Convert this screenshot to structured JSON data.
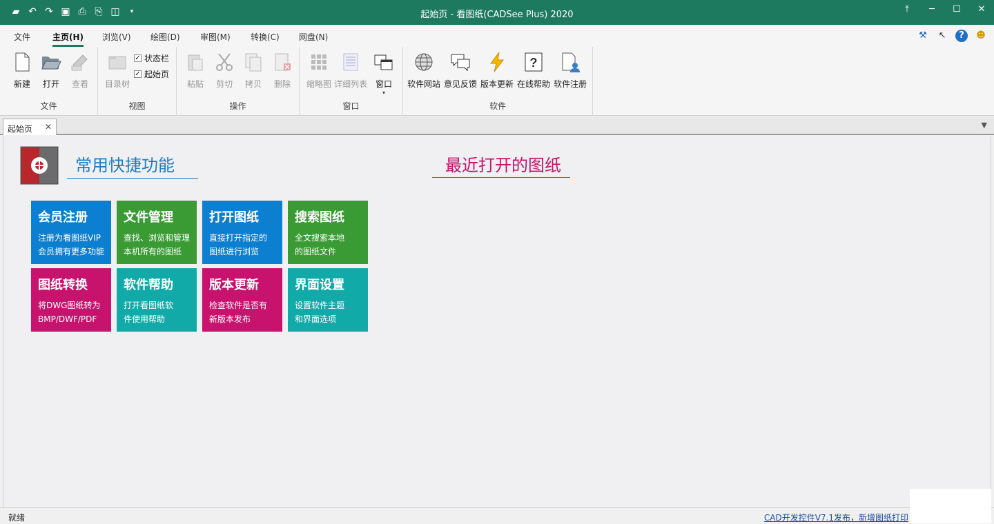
{
  "window": {
    "title": "起始页 - 看图纸(CADSee Plus) 2020"
  },
  "menu": {
    "tabs": [
      "文件",
      "主页(H)",
      "浏览(V)",
      "绘图(D)",
      "审图(M)",
      "转换(C)",
      "网盘(N)"
    ]
  },
  "ribbon": {
    "file": {
      "label": "文件",
      "new": "新建",
      "open": "打开",
      "view": "查看"
    },
    "view": {
      "label": "视图",
      "tree": "目录树",
      "statusbar": "状态栏",
      "startpage": "起始页"
    },
    "ops": {
      "label": "操作",
      "paste": "粘贴",
      "cut": "剪切",
      "copy": "拷贝",
      "delete": "删除"
    },
    "window": {
      "label": "窗口",
      "thumb": "缩略图",
      "detail": "详细列表",
      "win": "窗口"
    },
    "soft": {
      "label": "软件",
      "site": "软件网站",
      "feedback": "意见反馈",
      "update": "版本更新",
      "help": "在线帮助",
      "register": "软件注册"
    }
  },
  "doc_tab": {
    "label": "起始页"
  },
  "content": {
    "quick_title": "常用快捷功能",
    "recent_title": "最近打开的图纸",
    "tiles": [
      {
        "title": "会员注册",
        "desc1": "注册为看图纸VIP",
        "desc2": "会员拥有更多功能"
      },
      {
        "title": "文件管理",
        "desc1": "查找、浏览和管理",
        "desc2": "本机所有的图纸"
      },
      {
        "title": "打开图纸",
        "desc1": "直接打开指定的",
        "desc2": "图纸进行浏览"
      },
      {
        "title": "搜索图纸",
        "desc1": "全文搜索本地",
        "desc2": "的图纸文件"
      },
      {
        "title": "图纸转换",
        "desc1": "将DWG图纸转为",
        "desc2": "BMP/DWF/PDF"
      },
      {
        "title": "软件帮助",
        "desc1": "打开看图纸软",
        "desc2": "件使用帮助"
      },
      {
        "title": "版本更新",
        "desc1": "检查软件是否有",
        "desc2": "新版本发布"
      },
      {
        "title": "界面设置",
        "desc1": "设置软件主题",
        "desc2": "和界面选项"
      }
    ]
  },
  "status": {
    "left": "就绪",
    "right": "CAD开发控件V7.1发布，新增图纸打印"
  },
  "colors": {
    "titlebar": "#1e7a5e",
    "blue": "#0d7fd0",
    "green": "#3a9b35",
    "magenta": "#c8136e",
    "teal": "#12aaa8"
  }
}
